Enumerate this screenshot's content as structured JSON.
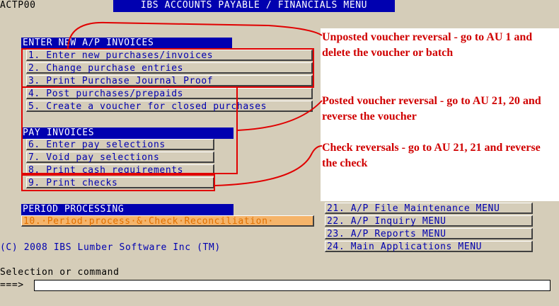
{
  "program_id": "ACTP00",
  "title": "IBS ACCOUNTS PAYABLE / FINANCIALS MENU",
  "sections": {
    "enter": "ENTER NEW A/P INVOICES",
    "pay": "PAY INVOICES",
    "period": "PERIOD PROCESSING"
  },
  "menu": {
    "item1": "1. Enter new purchases/invoices",
    "item2": "2. Change purchase entries",
    "item3": "3. Print Purchase Journal Proof",
    "item4": "4. Post purchases/prepaids",
    "item5": "5. Create a voucher for closed purchases",
    "item6": "6. Enter pay selections",
    "item7": "7. Void pay selections",
    "item8": "8. Print cash requirements",
    "item9": "9. Print checks",
    "item10": "10.·Period·process·&·Check·Reconciliation·",
    "item21": "21. A/P File Maintenance MENU",
    "item22": "22. A/P Inquiry MENU",
    "item23": "23. A/P Reports MENU",
    "item24": "24. Main Applications MENU"
  },
  "copyright": "(C) 2008 IBS Lumber Software Inc (TM)",
  "selection_label": "Selection or command",
  "prompt": "===>",
  "command_value": "",
  "annotations": {
    "unposted": "Unposted voucher reversal - go to AU 1 and delete the voucher or batch",
    "posted": "Posted voucher reversal - go to AU 21, 20 and reverse the voucher",
    "check": "Check reversals - go to AU 21, 21 and reverse the check"
  },
  "colors": {
    "background": "#d5cdb9",
    "menu_text": "#0000b0",
    "section_bg": "#0000b0",
    "annotation": "#d00000",
    "highlight": "#f5b46a"
  }
}
